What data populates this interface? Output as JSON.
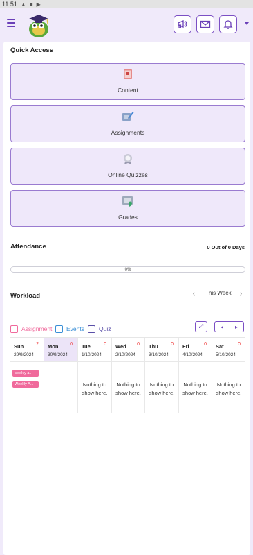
{
  "status_bar": {
    "time": "11:51"
  },
  "quick_access": {
    "title": "Quick Access",
    "tiles": [
      {
        "label": "Content",
        "icon": "book-icon"
      },
      {
        "label": "Assignments",
        "icon": "assignment-pencil-icon"
      },
      {
        "label": "Online Quizzes",
        "icon": "quiz-badge-icon"
      },
      {
        "label": "Grades",
        "icon": "grades-certificate-icon"
      }
    ]
  },
  "attendance": {
    "title": "Attendance",
    "summary": "0 Out of 0 Days",
    "progress_percent": 0,
    "progress_label": "0%"
  },
  "workload": {
    "title": "Workload",
    "week_label": "This Week",
    "legend": [
      {
        "label": "Assignment",
        "color": "#f06a9c"
      },
      {
        "label": "Events",
        "color": "#3a8fd6"
      },
      {
        "label": "Quiz",
        "color": "#5a4fa8"
      }
    ],
    "expand_icon": "expand-arrows-icon",
    "prev_icon": "chevron-left-icon",
    "next_icon": "chevron-right-icon",
    "days": [
      {
        "name": "Sun",
        "count": "2",
        "date": "29/9/2024",
        "empty_text": "",
        "events": [
          "weekly a...",
          "Weekly A..."
        ]
      },
      {
        "name": "Mon",
        "count": "0",
        "date": "30/9/2024",
        "empty_text": "",
        "events": [],
        "active": true
      },
      {
        "name": "Tue",
        "count": "0",
        "date": "1/10/2024",
        "empty_text": "Nothing to show here.",
        "events": []
      },
      {
        "name": "Wed",
        "count": "0",
        "date": "2/10/2024",
        "empty_text": "Nothing to show here.",
        "events": []
      },
      {
        "name": "Thu",
        "count": "0",
        "date": "3/10/2024",
        "empty_text": "Nothing to show here.",
        "events": []
      },
      {
        "name": "Fri",
        "count": "0",
        "date": "4/10/2024",
        "empty_text": "Nothing to show here.",
        "events": []
      },
      {
        "name": "Sat",
        "count": "0",
        "date": "5/10/2024",
        "empty_text": "Nothing to show here.",
        "events": []
      }
    ]
  },
  "colors": {
    "accent": "#7b4fc4",
    "tile_bg": "#efe8fa",
    "page_bg": "#f0eafa"
  }
}
